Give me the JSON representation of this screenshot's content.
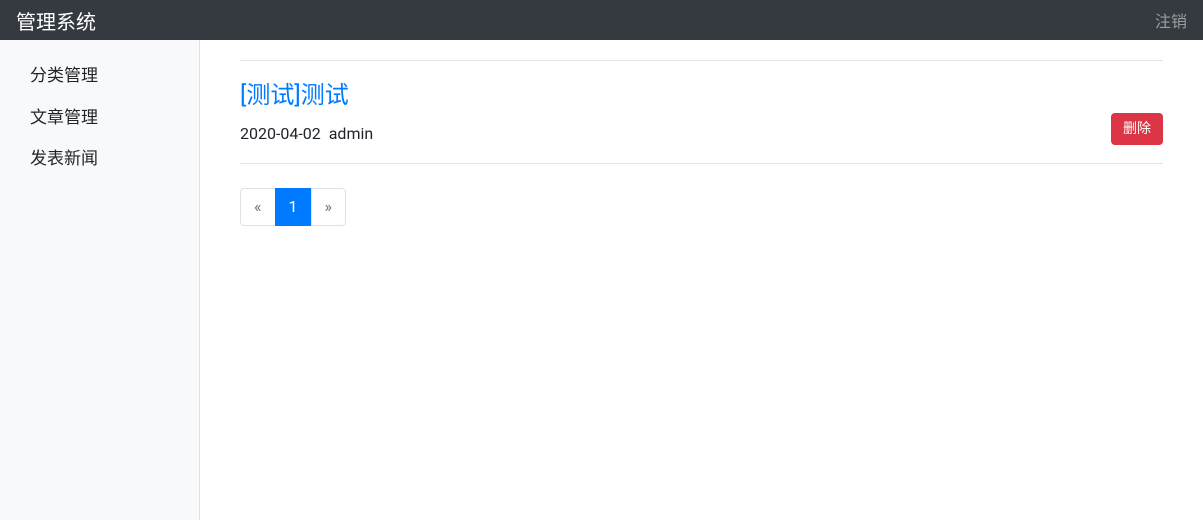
{
  "navbar": {
    "brand": "管理系统",
    "logout": "注销"
  },
  "sidebar": {
    "items": [
      {
        "label": "分类管理"
      },
      {
        "label": "文章管理"
      },
      {
        "label": "发表新闻"
      }
    ]
  },
  "articles": [
    {
      "title": "[测试]测试",
      "date": "2020-04-02",
      "author": "admin",
      "delete_label": "删除"
    }
  ],
  "pagination": {
    "prev": "«",
    "next": "»",
    "pages": [
      "1"
    ],
    "current": "1"
  }
}
